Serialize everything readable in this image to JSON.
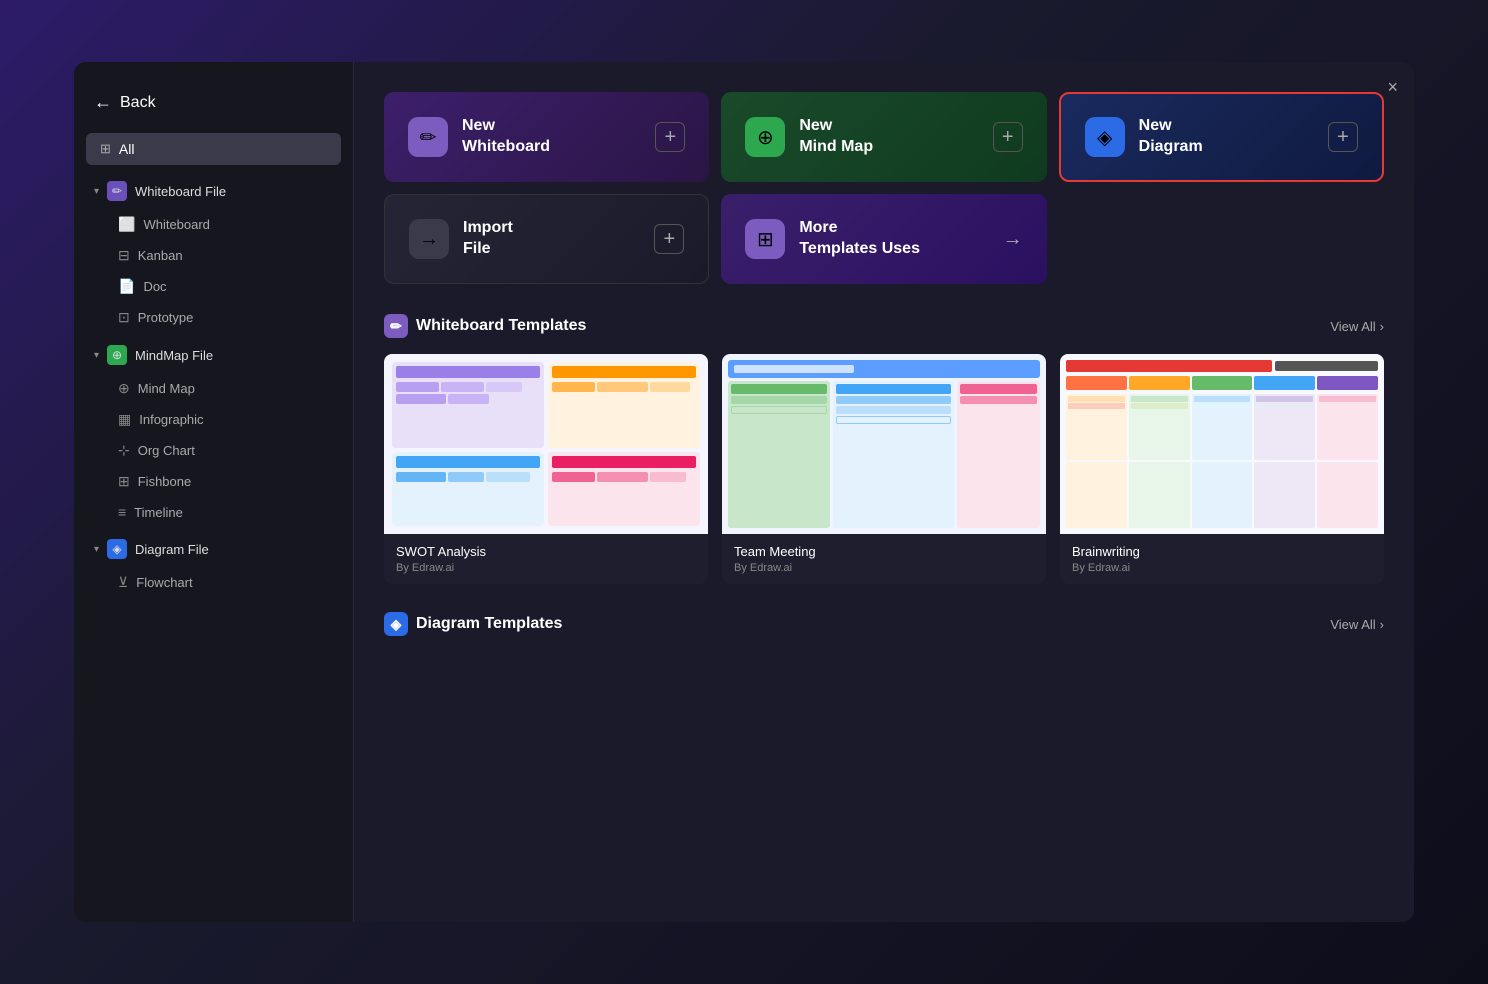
{
  "sidebar": {
    "back_label": "Back",
    "all_label": "All",
    "sections": [
      {
        "id": "whiteboard",
        "label": "Whiteboard File",
        "icon_color": "purple",
        "items": [
          "Whiteboard",
          "Kanban",
          "Doc",
          "Prototype"
        ]
      },
      {
        "id": "mindmap",
        "label": "MindMap File",
        "icon_color": "green",
        "items": [
          "Mind Map",
          "Infographic",
          "Org Chart",
          "Fishbone",
          "Timeline"
        ]
      },
      {
        "id": "diagram",
        "label": "Diagram File",
        "icon_color": "blue",
        "items": [
          "Flowchart"
        ]
      }
    ]
  },
  "close_button": "×",
  "action_cards": [
    {
      "id": "whiteboard",
      "title_line1": "New",
      "title_line2": "Whiteboard",
      "icon": "✏",
      "icon_bg": "purple-bg",
      "action": "plus",
      "style": "whiteboard"
    },
    {
      "id": "mindmap",
      "title_line1": "New",
      "title_line2": "Mind Map",
      "icon": "⊕",
      "icon_bg": "green-bg",
      "action": "plus",
      "style": "mindmap"
    },
    {
      "id": "diagram",
      "title_line1": "New",
      "title_line2": "Diagram",
      "icon": "◈",
      "icon_bg": "blue-bg",
      "action": "plus",
      "style": "diagram"
    },
    {
      "id": "import",
      "title_line1": "Import",
      "title_line2": "File",
      "icon": "→",
      "icon_bg": "dark-bg",
      "action": "plus",
      "style": "import"
    },
    {
      "id": "templates",
      "title_line1": "More",
      "title_line2": "Templates Uses",
      "icon": "⊞",
      "icon_bg": "purple2-bg",
      "action": "arrow",
      "style": "templates"
    }
  ],
  "whiteboard_section": {
    "title": "Whiteboard Templates",
    "view_all": "View All",
    "templates": [
      {
        "name": "SWOT Analysis",
        "author": "By Edraw.ai",
        "type": "swot"
      },
      {
        "name": "Team Meeting",
        "author": "By Edraw.ai",
        "type": "team"
      },
      {
        "name": "Brainwriting",
        "author": "By Edraw.ai",
        "type": "brain"
      }
    ]
  },
  "diagram_section": {
    "title": "Diagram Templates",
    "view_all": "View All"
  }
}
